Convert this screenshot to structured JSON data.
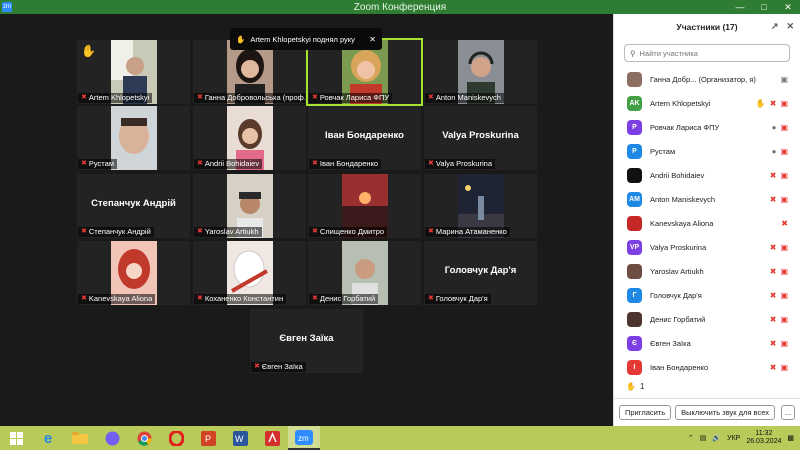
{
  "window": {
    "title": "Zoom Конференция",
    "app_icon_label": "zm"
  },
  "toast": {
    "text": "Artem Khlopetskyi поднял руку"
  },
  "tiles": [
    {
      "name": "Artem Khlopetskyi",
      "big": "",
      "kind": "photo",
      "photo": "man-window",
      "hand": true
    },
    {
      "name": "Ганна Добровольська (проф...",
      "big": "",
      "kind": "photo",
      "photo": "woman-dark"
    },
    {
      "name": "Ровчак Лариса ФПУ",
      "big": "",
      "kind": "photo",
      "photo": "woman-blonde",
      "active": true
    },
    {
      "name": "Anton Maniskevych",
      "big": "",
      "kind": "photo",
      "photo": "man-headset"
    },
    {
      "name": "Рустам",
      "big": "",
      "kind": "photo",
      "photo": "man-face"
    },
    {
      "name": "Andrii Bohidaiev",
      "big": "",
      "kind": "photo",
      "photo": "girl-pink"
    },
    {
      "name": "Іван Бондаренко",
      "big": "Іван Бондаренко",
      "kind": "name"
    },
    {
      "name": "Valya Proskurina",
      "big": "Valya Proskurina",
      "kind": "name"
    },
    {
      "name": "Степанчук Андрій",
      "big": "Степанчук Андрій",
      "kind": "name"
    },
    {
      "name": "Yaroslav Artiukh",
      "big": "",
      "kind": "photo",
      "photo": "man-cap"
    },
    {
      "name": "Слищенко Дмитро",
      "big": "",
      "kind": "photo",
      "photo": "sunset"
    },
    {
      "name": "Марина Атаманенко",
      "big": "",
      "kind": "photo",
      "photo": "night-street"
    },
    {
      "name": "Kanevskaya Aliona",
      "big": "",
      "kind": "photo",
      "photo": "anime-red"
    },
    {
      "name": "Коханенко Константин",
      "big": "",
      "kind": "photo",
      "photo": "anime-white"
    },
    {
      "name": "Денис Горбатий",
      "big": "",
      "kind": "photo",
      "photo": "man-smile"
    },
    {
      "name": "Головчук Дар'я",
      "big": "Головчук Дар'я",
      "kind": "name"
    },
    {
      "name": "Євген Заїка",
      "big": "Євген Заїка",
      "kind": "name"
    }
  ],
  "panel": {
    "title": "Участники (17)",
    "search_placeholder": "Найти участника",
    "participants": [
      {
        "initials": "",
        "color": "#8d6e63",
        "name": "Ганна Добр...  (Организатор, я)",
        "icons": [
          "video-gray"
        ]
      },
      {
        "initials": "AK",
        "color": "#43a047",
        "name": "Artem Khlopetskyi",
        "icons": [
          "hand",
          "mic-muted",
          "video-muted"
        ]
      },
      {
        "initials": "Р",
        "color": "#7b3fe4",
        "name": "Ровчак Лариса ФПУ",
        "icons": [
          "mic-on",
          "video-muted"
        ]
      },
      {
        "initials": "Р",
        "color": "#1e88e5",
        "name": "Рустам",
        "icons": [
          "mic-on",
          "video-muted"
        ]
      },
      {
        "initials": "",
        "color": "#111111",
        "name": "Andrii Bohidaiev",
        "icons": [
          "mic-muted",
          "video-muted"
        ]
      },
      {
        "initials": "AM",
        "color": "#1e88e5",
        "name": "Anton Maniskevych",
        "icons": [
          "mic-muted",
          "video-muted"
        ]
      },
      {
        "initials": "",
        "color": "#c62828",
        "name": "Kanevskaya Aliona",
        "icons": [
          "mic-muted"
        ]
      },
      {
        "initials": "VP",
        "color": "#7b3fe4",
        "name": "Valya Proskurina",
        "icons": [
          "mic-muted",
          "video-muted"
        ]
      },
      {
        "initials": "",
        "color": "#6d4c41",
        "name": "Yaroslav Artiukh",
        "icons": [
          "mic-muted",
          "video-muted"
        ]
      },
      {
        "initials": "Г",
        "color": "#1e88e5",
        "name": "Головчук Дар'я",
        "icons": [
          "mic-muted",
          "video-muted"
        ]
      },
      {
        "initials": "",
        "color": "#4e342e",
        "name": "Денис Горбатий",
        "icons": [
          "mic-muted",
          "video-muted"
        ]
      },
      {
        "initials": "Є",
        "color": "#7b3fe4",
        "name": "Євген Заїка",
        "icons": [
          "mic-muted",
          "video-muted"
        ]
      },
      {
        "initials": "І",
        "color": "#e53935",
        "name": "Іван Бондаренко",
        "icons": [
          "mic-muted",
          "video-muted"
        ]
      }
    ],
    "hand_count": "1",
    "invite_label": "Пригласить",
    "mute_all_label": "Выключить звук для всех",
    "more_label": "..."
  },
  "taskbar": {
    "lang": "УКР",
    "time": "11:32",
    "date": "26.03.2024",
    "zoom_label": "zm"
  }
}
